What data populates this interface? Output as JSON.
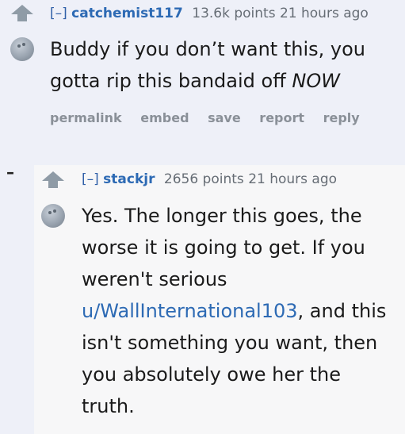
{
  "comment1": {
    "toggle": "[–]",
    "author": "catchemist117",
    "score": "13.6k points",
    "time": "21 hours ago",
    "line1": "Buddy if you don’t want this, you",
    "line2_prefix": "gotta rip this bandaid off ",
    "line2_em": "NOW",
    "buttons": [
      "permalink",
      "embed",
      "save",
      "report",
      "reply"
    ]
  },
  "comment2": {
    "collapse": "–",
    "toggle": "[–]",
    "author": "stackjr",
    "score": "2656 points",
    "time": "21 hours ago",
    "line1": "Yes. The longer this goes, the",
    "line2": "worse it is going to get. If you",
    "line3": "weren't serious",
    "line4_link": "u/WallInternational103",
    "line4_rest": ", and this",
    "line5": "isn't something you want, then",
    "line6": "you absolutely owe her the",
    "line7": "truth."
  }
}
